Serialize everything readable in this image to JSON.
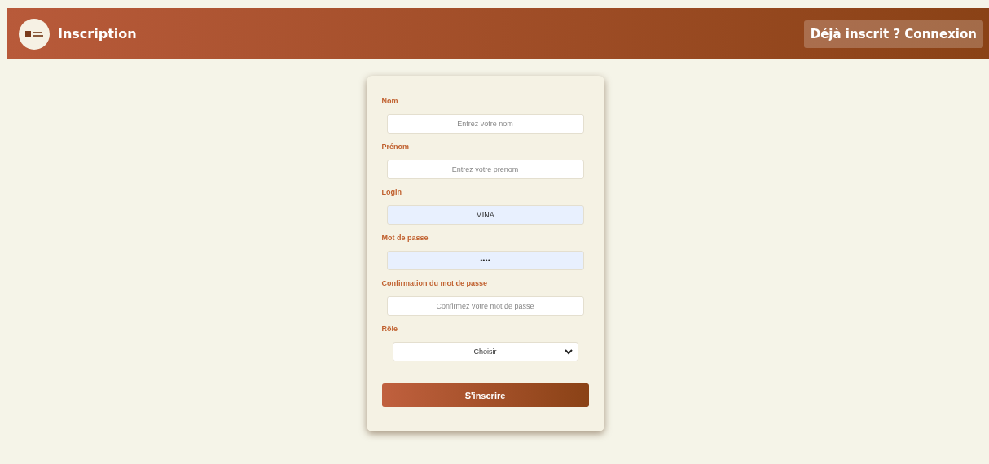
{
  "header": {
    "title": "Inscription",
    "login_link": "Déjà inscrit ? Connexion"
  },
  "form": {
    "fields": [
      {
        "kind": "input",
        "label": "Nom",
        "placeholder": "Entrez votre nom",
        "autofilled": false
      },
      {
        "kind": "input",
        "label": "Prénom",
        "placeholder": "Entrez votre prenom",
        "autofilled": false
      },
      {
        "kind": "input",
        "label": "Login",
        "value": "MINA",
        "autofilled": true
      },
      {
        "kind": "input",
        "label": "Mot de passe",
        "value": "••••",
        "autofilled": true
      },
      {
        "kind": "input",
        "label": "Confirmation du mot de passe",
        "placeholder": "Confirmez votre mot de passe",
        "autofilled": false
      },
      {
        "kind": "select",
        "label": "Rôle",
        "value": "-- Choisir --",
        "autofilled": false
      }
    ],
    "submit": "S'inscrire"
  }
}
